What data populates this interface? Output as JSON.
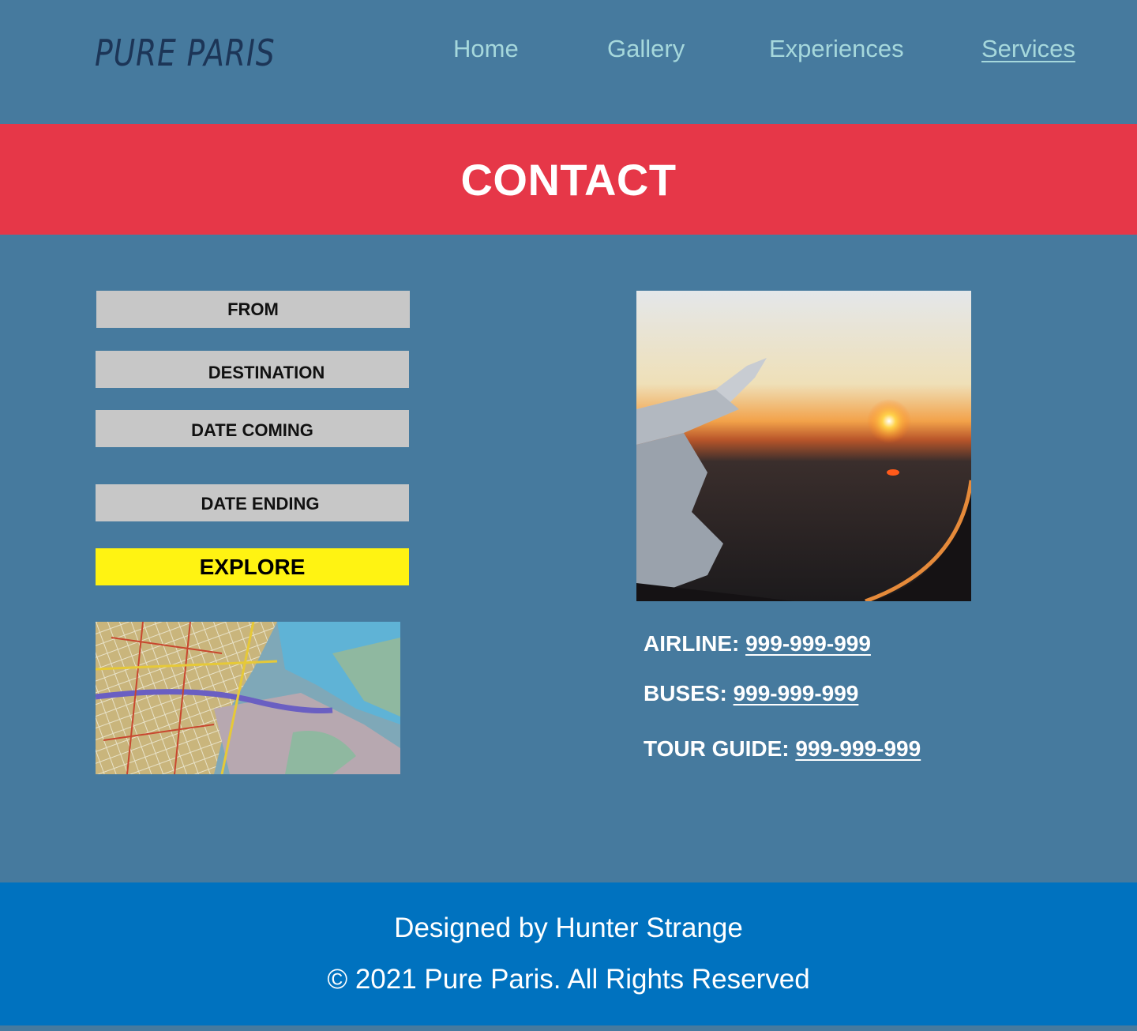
{
  "header": {
    "logo": "PURE PARIS",
    "nav": [
      {
        "label": "Home",
        "active": false
      },
      {
        "label": "Gallery",
        "active": false
      },
      {
        "label": "Experiences",
        "active": false
      },
      {
        "label": "Services",
        "active": true
      }
    ]
  },
  "banner": {
    "title": "CONTACT"
  },
  "form": {
    "from_label": "FROM",
    "destination_label": "DESTINATION",
    "date_coming_label": "DATE COMING",
    "date_ending_label": "DATE ENDING",
    "explore_label": "EXPLORE"
  },
  "images": {
    "map": "city-map-photo",
    "plane": "airplane-window-sunset-photo"
  },
  "contacts": [
    {
      "label": "AIRLINE:",
      "phone": "999-999-999"
    },
    {
      "label": "BUSES:",
      "phone": "999-999-999"
    },
    {
      "label": "TOUR GUIDE:",
      "phone": "999-999-999"
    }
  ],
  "footer": {
    "credit": "Designed by Hunter Strange",
    "copyright": "© 2021 Pure Paris. All Rights Reserved"
  },
  "colors": {
    "page_bg": "#467a9e",
    "banner_bg": "#e63748",
    "footer_bg": "#0072bf",
    "nav_link": "#a6d8dc",
    "logo": "#1c3557",
    "field_bg": "#c7c7c7",
    "explore_bg": "#fff312"
  }
}
